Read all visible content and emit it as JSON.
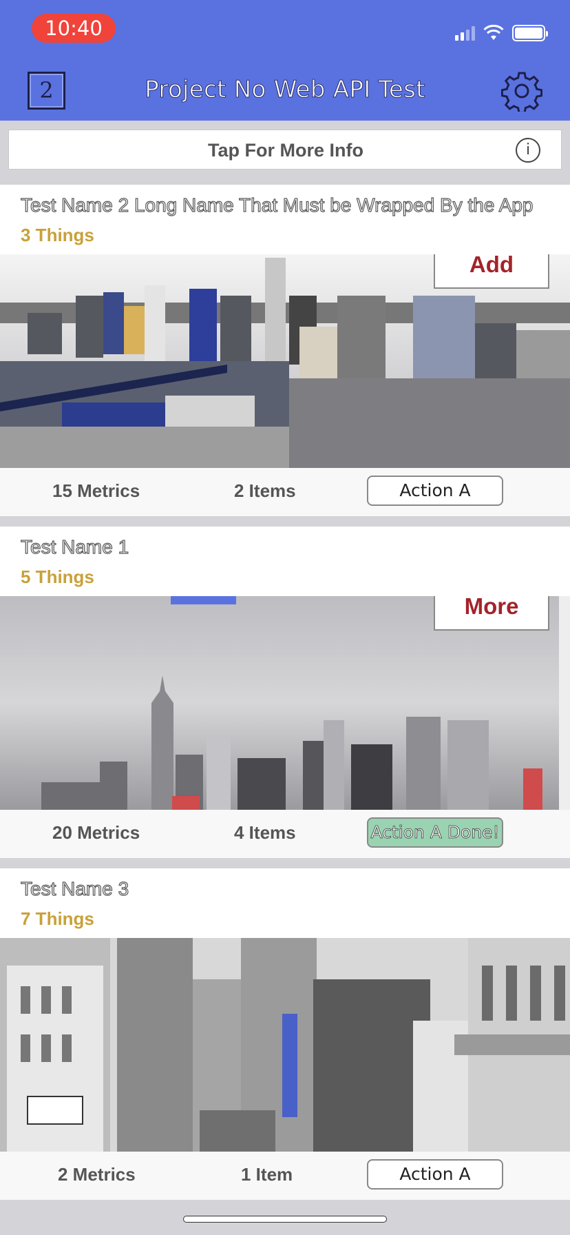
{
  "status_bar": {
    "time": "10:40"
  },
  "nav": {
    "badge": "2",
    "title": "Project No Web API Test"
  },
  "info_bar": {
    "label": "Tap For More Info",
    "icon": "i"
  },
  "cards": [
    {
      "name": "Test Name 2 Long Name That Must be Wrapped By the App",
      "things": "3 Things",
      "overlay_button": "Add",
      "metrics": "15 Metrics",
      "items": "2 Items",
      "action": "Action A"
    },
    {
      "name": "Test Name 1",
      "things": "5 Things",
      "overlay_button": "More",
      "metrics": "20 Metrics",
      "items": "4 Items",
      "action": "Action A Done!"
    },
    {
      "name": "Test Name 3",
      "things": "7 Things",
      "overlay_button": "",
      "metrics": "2 Metrics",
      "items": "1 Item",
      "action": "Action A"
    }
  ],
  "colors": {
    "nav_bg": "#5a72e0",
    "time_pill": "#f0433a",
    "things_text": "#c9a13a",
    "overlay_text": "#a3232a",
    "done_button": "#9ad3b1"
  }
}
